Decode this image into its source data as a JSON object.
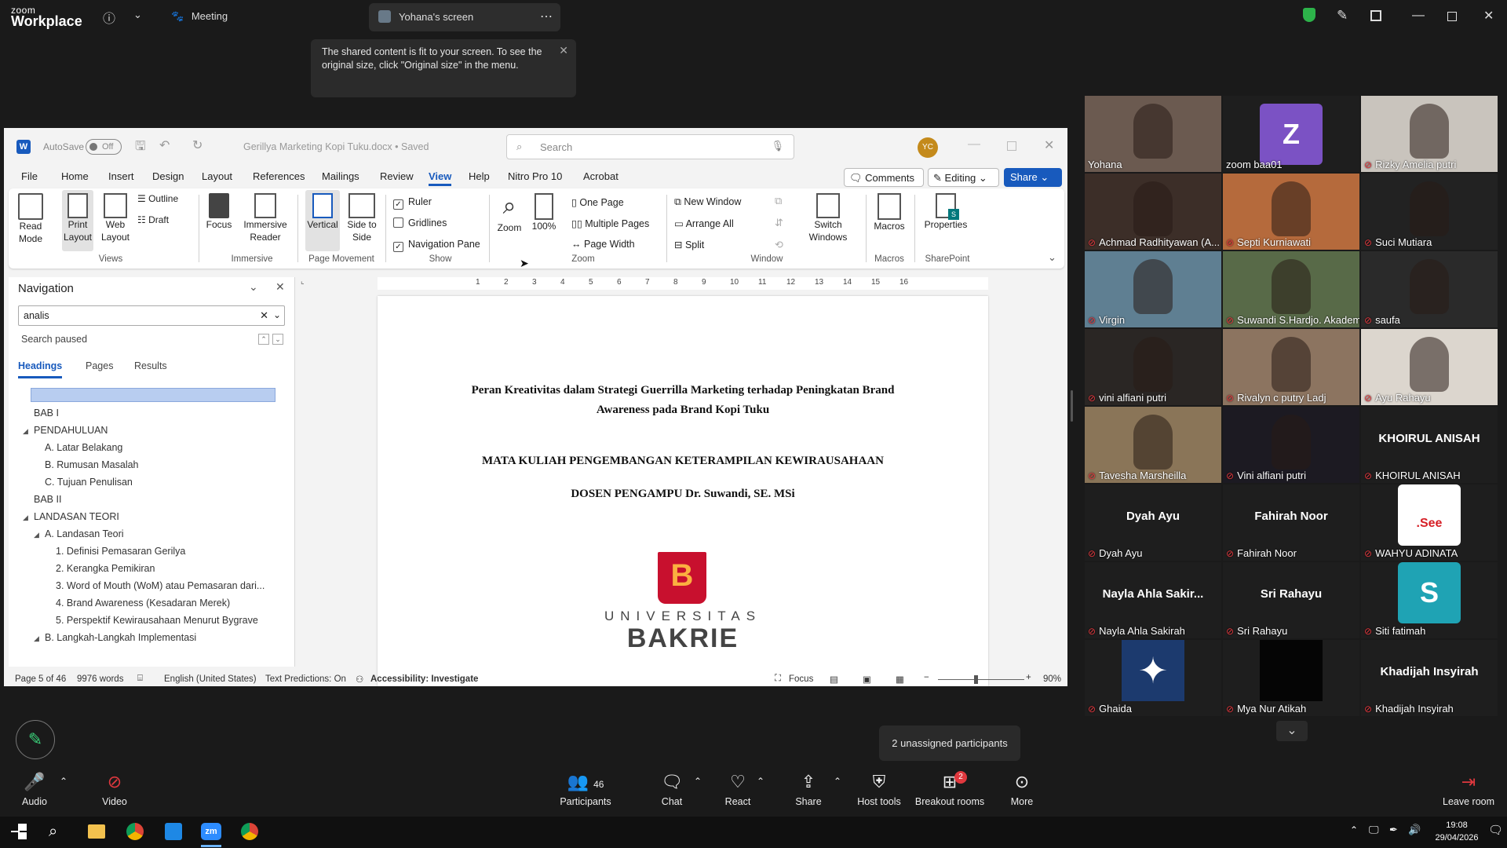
{
  "zoom": {
    "logo_top": "zoom",
    "logo_bottom": "Workplace",
    "meeting_label": "Meeting",
    "screen_tab_label": "Yohana's screen",
    "tooltip_text": "The shared content is fit to your screen. To see the original size, click \"Original size\" in the menu."
  },
  "word": {
    "autosave_label": "AutoSave",
    "autosave_state": "Off",
    "doc_title": "Gerillya Marketing Kopi Tuku.docx • Saved",
    "search_placeholder": "Search",
    "avatar_initials": "YC",
    "menu": [
      "File",
      "Home",
      "Insert",
      "Design",
      "Layout",
      "References",
      "Mailings",
      "Review",
      "View",
      "Help",
      "Nitro Pro 10",
      "Acrobat"
    ],
    "comments_label": "Comments",
    "editing_label": "Editing",
    "share_label": "Share",
    "ribbon": {
      "read_mode": "Read Mode",
      "print_layout": "Print Layout",
      "web_layout": "Web Layout",
      "outline": "Outline",
      "draft": "Draft",
      "views_group": "Views",
      "focus": "Focus",
      "immersive_reader": "Immersive Reader",
      "immersive_group": "Immersive",
      "vertical": "Vertical",
      "side_to_side": "Side to Side",
      "page_movement_group": "Page Movement",
      "ruler": "Ruler",
      "gridlines": "Gridlines",
      "navigation_pane": "Navigation Pane",
      "show_group": "Show",
      "zoom": "Zoom",
      "hundred": "100%",
      "one_page": "One Page",
      "multiple_pages": "Multiple Pages",
      "page_width": "Page Width",
      "zoom_group": "Zoom",
      "new_window": "New Window",
      "arrange_all": "Arrange All",
      "split": "Split",
      "switch_windows": "Switch Windows",
      "window_group": "Window",
      "macros": "Macros",
      "macros_group": "Macros",
      "properties": "Properties",
      "sharepoint_group": "SharePoint"
    },
    "nav": {
      "title": "Navigation",
      "search_value": "analis",
      "search_status": "Search paused",
      "tabs": [
        "Headings",
        "Pages",
        "Results"
      ],
      "items": [
        {
          "text": "BAB I",
          "level": 0,
          "arrow": false
        },
        {
          "text": "PENDAHULUAN",
          "level": 0,
          "arrow": true
        },
        {
          "text": "A. Latar Belakang",
          "level": 1,
          "arrow": false
        },
        {
          "text": "B. Rumusan Masalah",
          "level": 1,
          "arrow": false
        },
        {
          "text": "C. Tujuan Penulisan",
          "level": 1,
          "arrow": false
        },
        {
          "text": "BAB II",
          "level": 0,
          "arrow": false
        },
        {
          "text": "LANDASAN TEORI",
          "level": 0,
          "arrow": true
        },
        {
          "text": "A. Landasan Teori",
          "level": 1,
          "arrow": true
        },
        {
          "text": "1. Definisi Pemasaran Gerilya",
          "level": 2,
          "arrow": false
        },
        {
          "text": "2. Kerangka Pemikiran",
          "level": 2,
          "arrow": false
        },
        {
          "text": "3. Word of Mouth (WoM) atau Pemasaran dari...",
          "level": 2,
          "arrow": false
        },
        {
          "text": "4. Brand Awareness (Kesadaran Merek)",
          "level": 2,
          "arrow": false
        },
        {
          "text": "5. Perspektif Kewirausahaan Menurut Bygrave",
          "level": 2,
          "arrow": false
        },
        {
          "text": "B.  Langkah-Langkah Implementasi",
          "level": 1,
          "arrow": true
        }
      ]
    },
    "ruler_numbers": [
      "1",
      "2",
      "3",
      "4",
      "5",
      "6",
      "7",
      "8",
      "9",
      "10",
      "11",
      "12",
      "13",
      "14",
      "15",
      "16"
    ],
    "doc": {
      "title_line1": "Peran Kreativitas dalam Strategi Guerrilla Marketing terhadap Peningkatan Brand",
      "title_line2": "Awareness pada Brand Kopi Tuku",
      "course": "MATA KULIAH PENGEMBANGAN KETERAMPILAN KEWIRAUSAHAAN",
      "lecturer": "DOSEN PENGAMPU Dr. Suwandi, SE. MSi",
      "logo_line1": "UNIVERSITAS",
      "logo_line2": "BAKRIE"
    },
    "status": {
      "page": "Page 5 of 46",
      "words": "9976 words",
      "language": "English (United States)",
      "predictions": "Text Predictions: On",
      "accessibility": "Accessibility: Investigate",
      "focus": "Focus",
      "zoom": "90%"
    }
  },
  "participants": [
    {
      "name": "Yohana",
      "type": "video",
      "muted": false,
      "bg": "#6b5a50",
      "active": true
    },
    {
      "name": "zoom baa01",
      "type": "letter",
      "letter": "Z",
      "letter_bg": "#7b52c4",
      "muted": false
    },
    {
      "name": "Rizky Amelia putri",
      "type": "video",
      "muted": true,
      "bg": "#c9c4bd"
    },
    {
      "name": "Achmad Radhityawan (A...",
      "type": "video",
      "muted": true,
      "bg": "#3c2e28"
    },
    {
      "name": "Septi Kurniawati",
      "type": "video",
      "muted": true,
      "bg": "#b56a3c"
    },
    {
      "name": "Suci Mutiara",
      "type": "video",
      "muted": true,
      "bg": "#222222"
    },
    {
      "name": "Virgin",
      "type": "video",
      "muted": true,
      "bg": "#5f7f92"
    },
    {
      "name": "Suwandi S.Hardjo. Akademi...",
      "type": "video",
      "muted": true,
      "bg": "#586a48"
    },
    {
      "name": "saufa",
      "type": "video",
      "muted": true,
      "bg": "#2a2a2a"
    },
    {
      "name": "vini alfiani putri",
      "type": "video",
      "muted": true,
      "bg": "#2a2624"
    },
    {
      "name": "Rivalyn c putry Ladj",
      "type": "video",
      "muted": true,
      "bg": "#8c7460"
    },
    {
      "name": "Ayu Rahayu",
      "type": "video",
      "muted": true,
      "bg": "#dcd6ce"
    },
    {
      "name": "Tavesha Marsheilla",
      "type": "video",
      "muted": true,
      "bg": "#8a7558"
    },
    {
      "name": "Vini alfiani putri",
      "type": "video",
      "muted": true,
      "bg": "#1c1a22"
    },
    {
      "name": "KHOIRUL ANISAH",
      "type": "name",
      "muted": true
    },
    {
      "name": "Dyah Ayu",
      "type": "name",
      "muted": true
    },
    {
      "name": "Fahirah Noor",
      "type": "name",
      "muted": true
    },
    {
      "name": "WAHYU ADINATA",
      "type": "logo",
      "muted": true,
      "logo_text": ".See"
    },
    {
      "name": "Nayla Ahla Sakirah",
      "type": "name",
      "display": "Nayla  Ahla  Sakir...",
      "muted": true
    },
    {
      "name": "Sri Rahayu",
      "type": "name",
      "muted": true
    },
    {
      "name": "Siti fatimah",
      "type": "letter",
      "letter": "S",
      "letter_bg": "#1fa3b4",
      "muted": true
    },
    {
      "name": "Ghaida",
      "type": "image",
      "muted": true,
      "bg": "#1c3a6e"
    },
    {
      "name": "Mya Nur Atikah",
      "type": "image",
      "muted": true,
      "bg": "#050505"
    },
    {
      "name": "Khadijah Insyirah",
      "type": "name",
      "muted": true
    }
  ],
  "unassigned_label": "2 unassigned participants",
  "toolbar": {
    "audio": "Audio",
    "video": "Video",
    "participants": "Participants",
    "participants_count": "46",
    "chat": "Chat",
    "react": "React",
    "share": "Share",
    "host_tools": "Host tools",
    "breakout_rooms": "Breakout rooms",
    "breakout_badge": "2",
    "more": "More",
    "leave_room": "Leave room"
  },
  "taskbar": {
    "time": "19:08",
    "date": "29/04/2026"
  },
  "colors": {
    "word_blue": "#185abd",
    "active_speaker": "#23d959",
    "muted_red": "#e0383e"
  }
}
